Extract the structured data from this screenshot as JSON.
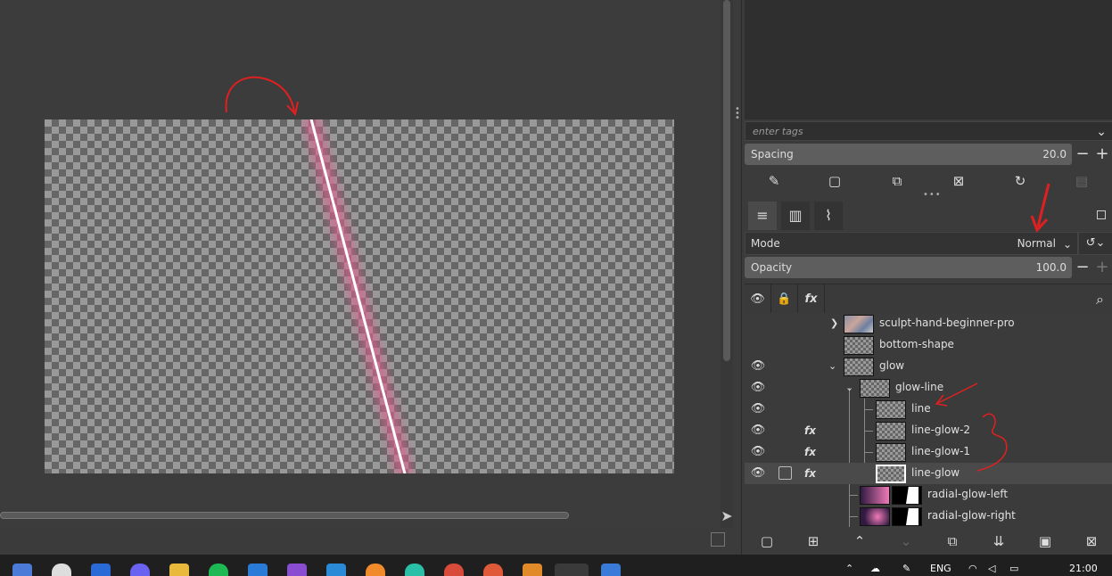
{
  "brushes": {
    "tags_placeholder": "enter tags",
    "spacing_label": "Spacing",
    "spacing_value": "20.0"
  },
  "tabs": [
    {
      "name": "layers",
      "icon": "layers-icon"
    },
    {
      "name": "channels",
      "icon": "channels-icon"
    },
    {
      "name": "paths",
      "icon": "paths-icon"
    }
  ],
  "layers_panel": {
    "mode_label": "Mode",
    "mode_value": "Normal",
    "opacity_label": "Opacity",
    "opacity_value": "100.0",
    "layers": [
      {
        "name": "sculpt-hand-beginner-pro",
        "visible": false,
        "fx": false,
        "expanded": false
      },
      {
        "name": "bottom-shape",
        "visible": false,
        "fx": false
      },
      {
        "name": "glow",
        "visible": true,
        "fx": false,
        "expanded": true
      },
      {
        "name": "glow-line",
        "visible": true,
        "fx": false,
        "expanded": true
      },
      {
        "name": "line",
        "visible": true,
        "fx": false
      },
      {
        "name": "line-glow-2",
        "visible": true,
        "fx": true
      },
      {
        "name": "line-glow-1",
        "visible": true,
        "fx": true
      },
      {
        "name": "line-glow",
        "visible": true,
        "fx": true,
        "selected": true
      },
      {
        "name": "radial-glow-left",
        "visible": false,
        "fx": false
      },
      {
        "name": "radial-glow-right",
        "visible": false,
        "fx": false
      }
    ]
  },
  "taskbar": {
    "language": "ENG",
    "time": "21:00"
  },
  "colors": {
    "glow_line": "#ffffff",
    "glow": "#e0608f",
    "annotation": "#e02020"
  }
}
